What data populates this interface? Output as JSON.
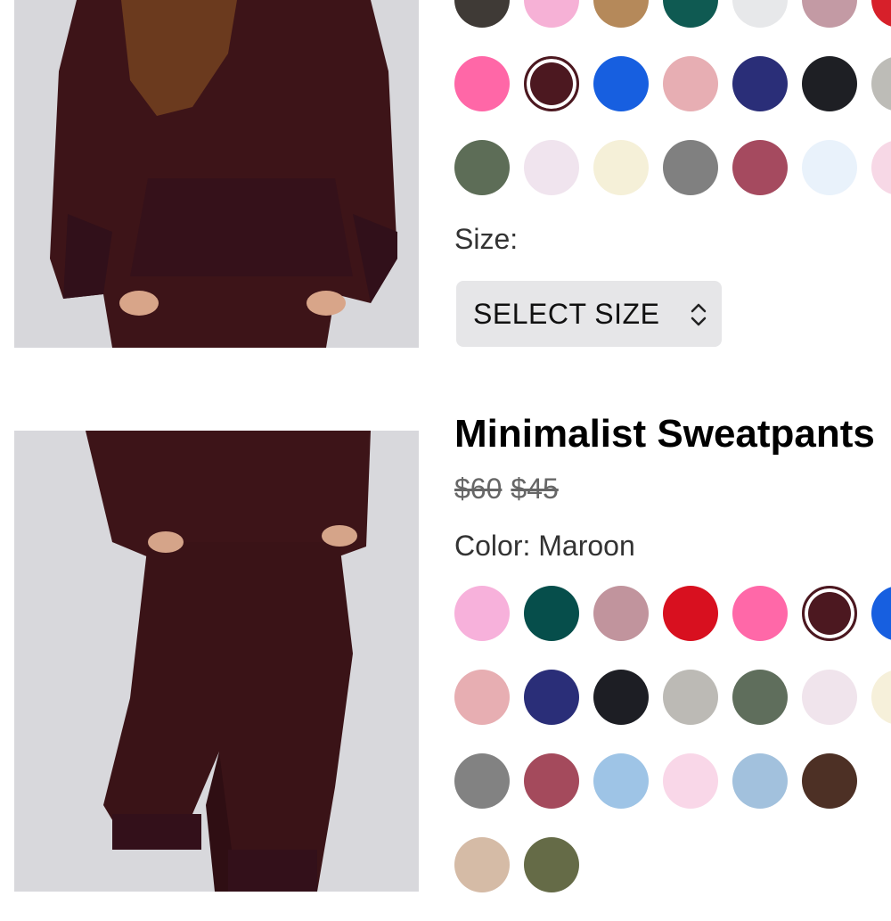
{
  "product_top": {
    "swatch_rows": [
      [
        "#3f3a36",
        "#f6b1d6",
        "#b5895a",
        "#0f5a52",
        "#e7e8ea",
        "#c39aa4",
        "#d7202a"
      ],
      [
        "#ff67a7",
        "#4c1820",
        "#175fe0",
        "#e7aeb3",
        "#2a2e78",
        "#1e1f24",
        "#bdbcb7"
      ],
      [
        "#5d6d57",
        "#f0e4ee",
        "#f5f0d8",
        "#808080",
        "#a54a5f",
        "#e9f2fb",
        "#f7d8e6"
      ]
    ],
    "selected_swatch": "#4c1820",
    "size_label": "Size:",
    "size_select": "SELECT SIZE"
  },
  "product_bottom": {
    "title": "Minimalist Sweatpants",
    "price_original": "$60",
    "price_sale": "$45",
    "color_label": "Color: Maroon",
    "swatch_rows": [
      [
        "#f7b1db",
        "#064e4b",
        "#c1949d",
        "#d8101f",
        "#ff68a8",
        "#4c1820",
        "#175fe0"
      ],
      [
        "#e7aeb2",
        "#2a2e78",
        "#1d1e24",
        "#bcbab5",
        "#5f6e5c",
        "#f0e4ec",
        "#f6f0da"
      ],
      [
        "#828282",
        "#a44a5c",
        "#9ec4e6",
        "#f9d7e8",
        "#a2c1dd",
        "#4d3025"
      ],
      [
        "#d5bba6",
        "#656b47"
      ]
    ],
    "selected_swatch": "#4c1820"
  }
}
